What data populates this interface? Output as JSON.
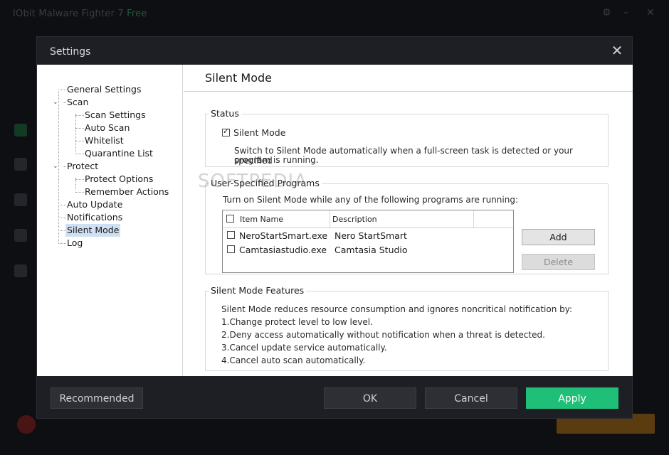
{
  "background_app": {
    "title": "IObit Malware Fighter 7",
    "edition": "Free"
  },
  "dialog": {
    "title": "Settings",
    "close_icon": "close-icon"
  },
  "tree": {
    "general_settings": "General Settings",
    "scan": "Scan",
    "scan_settings": "Scan Settings",
    "auto_scan": "Auto Scan",
    "whitelist": "Whitelist",
    "quarantine_list": "Quarantine List",
    "protect": "Protect",
    "protect_options": "Protect Options",
    "remember_actions": "Remember Actions",
    "auto_update": "Auto Update",
    "notifications": "Notifications",
    "silent_mode": "Silent Mode",
    "log": "Log",
    "selected": "Silent Mode"
  },
  "panel": {
    "title": "Silent Mode",
    "status": {
      "label": "Status",
      "checkbox_label": "Silent Mode",
      "checked": true,
      "desc_line1": "Switch to Silent Mode automatically when a full-screen task is detected or your specified",
      "desc_line2": "program is running."
    },
    "programs": {
      "label": "User-Specified Programs",
      "intro": "Turn on Silent Mode while any of the following programs are running:",
      "col_item": "Item Name",
      "col_desc": "Description",
      "rows": [
        {
          "name": "NeroStartSmart.exe",
          "desc": "Nero StartSmart",
          "checked": false
        },
        {
          "name": "Camtasiastudio.exe",
          "desc": "Camtasia Studio",
          "checked": false
        }
      ],
      "add_label": "Add",
      "delete_label": "Delete"
    },
    "features": {
      "label": "Silent Mode Features",
      "intro": "Silent Mode reduces resource consumption and ignores noncritical notification by:",
      "items": [
        "1.Change protect level to low level.",
        "2.Deny access automatically without notification when a threat is detected.",
        "3.Cancel update service automatically.",
        "4.Cancel auto scan automatically."
      ]
    }
  },
  "footer": {
    "recommended": "Recommended",
    "ok": "OK",
    "cancel": "Cancel",
    "apply": "Apply"
  },
  "watermark": "SOFTPEDIA",
  "colors": {
    "apply_green": "#1fbf78",
    "dialog_dark": "#1e1f24",
    "selection": "#cfe0f3"
  }
}
